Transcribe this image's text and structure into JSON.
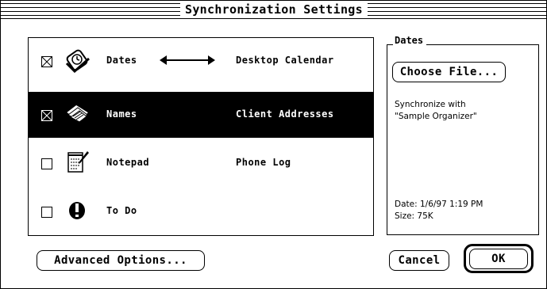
{
  "window": {
    "title": "Synchronization Settings"
  },
  "conduits": [
    {
      "label": "Dates",
      "target": "Desktop Calendar",
      "checked": true,
      "selected": false,
      "icon": "clock-icon",
      "direction": "two-way-arrow"
    },
    {
      "label": "Names",
      "target": "Client Addresses",
      "checked": true,
      "selected": true,
      "icon": "rolodex-icon",
      "direction": ""
    },
    {
      "label": "Notepad",
      "target": "Phone Log",
      "checked": false,
      "selected": false,
      "icon": "notepad-icon",
      "direction": ""
    },
    {
      "label": "To Do",
      "target": "",
      "checked": false,
      "selected": false,
      "icon": "exclamation-icon",
      "direction": ""
    }
  ],
  "details": {
    "group_label": "Dates",
    "choose_file_label": "Choose File...",
    "sync_line1": "Synchronize with",
    "sync_line2": "\"Sample Organizer\"",
    "date_line": "Date: 1/6/97 1:19 PM",
    "size_line": "Size: 75K"
  },
  "buttons": {
    "advanced_label": "Advanced Options...",
    "cancel_label": "Cancel",
    "ok_label": "OK"
  },
  "colors": {
    "foreground": "#000000",
    "background": "#ffffff"
  }
}
